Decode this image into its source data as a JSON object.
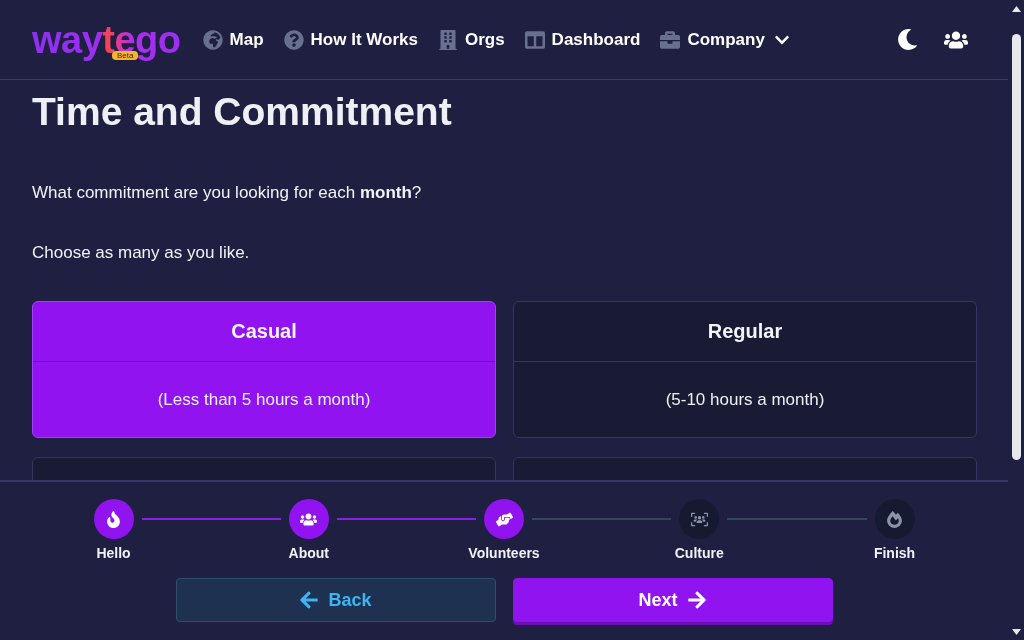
{
  "header": {
    "logo": {
      "text": "waytego",
      "badge": "Beta"
    },
    "nav": [
      {
        "label": "Map",
        "dropdown": false
      },
      {
        "label": "How It Works",
        "dropdown": false
      },
      {
        "label": "Orgs",
        "dropdown": false
      },
      {
        "label": "Dashboard",
        "dropdown": false
      },
      {
        "label": "Company",
        "dropdown": true
      }
    ]
  },
  "page": {
    "title": "Time and Commitment",
    "question": "What commitment are you looking for each **month**?",
    "hint": "Choose as many as you like."
  },
  "options": [
    {
      "title": "Casual",
      "subtitle": "(Less than 5 hours a month)",
      "selected": true
    },
    {
      "title": "Regular",
      "subtitle": "(5-10 hours a month)",
      "selected": false
    },
    {
      "selected": false
    },
    {
      "selected": false
    }
  ],
  "steps": [
    {
      "label": "Hello",
      "done": true
    },
    {
      "label": "About",
      "done": true
    },
    {
      "label": "Volunteers",
      "done": true
    },
    {
      "label": "Culture",
      "done": false
    },
    {
      "label": "Finish",
      "done": false
    }
  ],
  "buttons": [
    {
      "kind": "back",
      "label": "Back"
    },
    {
      "kind": "next",
      "label": "Next"
    }
  ]
}
